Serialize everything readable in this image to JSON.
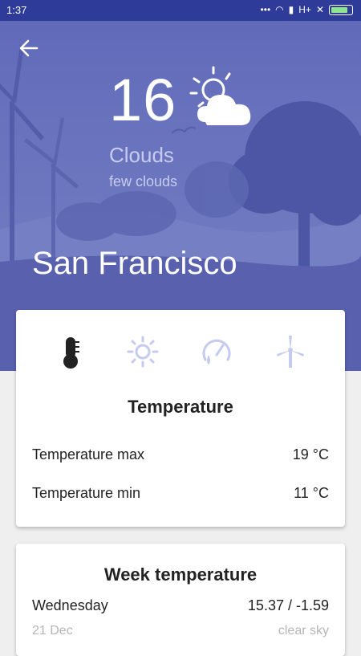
{
  "status_bar": {
    "time": "1:37",
    "network": "H+"
  },
  "header": {
    "temperature": "16",
    "condition": "Clouds",
    "description": "few clouds",
    "city": "San Francisco"
  },
  "detail_card": {
    "tabs": [
      {
        "icon": "thermometer-icon",
        "active": true
      },
      {
        "icon": "sun-icon",
        "active": false
      },
      {
        "icon": "pressure-gauge-icon",
        "active": false
      },
      {
        "icon": "wind-turbine-icon",
        "active": false
      }
    ],
    "title": "Temperature",
    "rows": [
      {
        "label": "Temperature max",
        "value": "19 °C"
      },
      {
        "label": "Temperature min",
        "value": "11 °C"
      }
    ]
  },
  "week_card": {
    "title": "Week temperature",
    "days": [
      {
        "day": "Wednesday",
        "temps": "15.37 / -1.59",
        "date": "21 Dec",
        "summary": "clear sky"
      }
    ]
  },
  "colors": {
    "status_bar": "#2f3b98",
    "hero": "#6a74be",
    "accent_inactive": "#c5cbef"
  }
}
